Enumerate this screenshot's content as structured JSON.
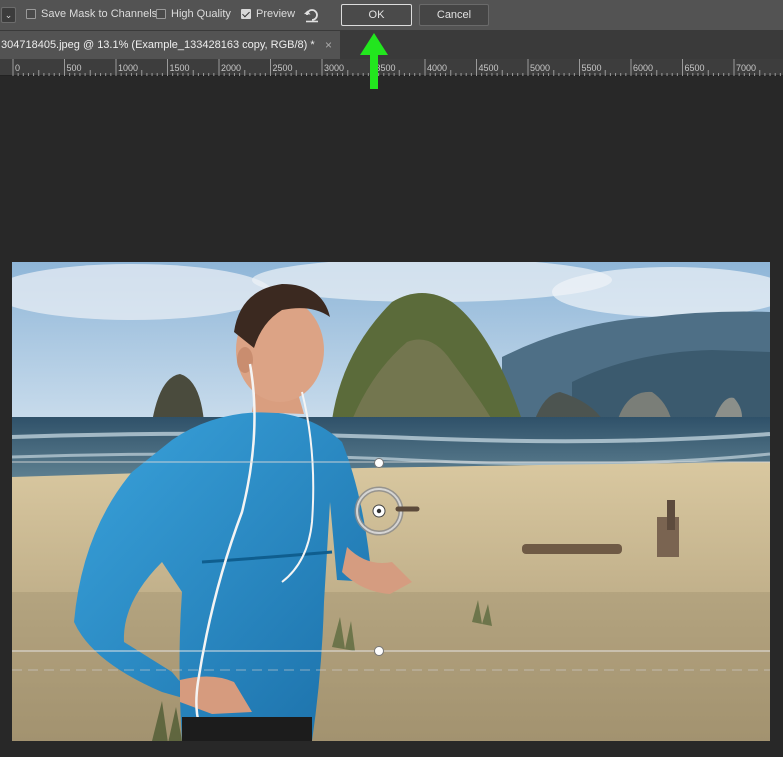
{
  "options_bar": {
    "save_mask_label": "Save Mask to Channels",
    "save_mask_checked": false,
    "high_quality_label": "High Quality",
    "high_quality_checked": false,
    "preview_label": "Preview",
    "preview_checked": true,
    "ok_label": "OK",
    "cancel_label": "Cancel",
    "reset_icon": "reset-icon"
  },
  "document_tab": {
    "title": "304718405.jpeg @ 13.1% (Example_133428163 copy, RGB/8) *",
    "close_glyph": "×"
  },
  "ruler": {
    "labels": [
      "0",
      "500",
      "1000",
      "1500",
      "2000",
      "2500",
      "3000",
      "3500",
      "4000",
      "4500",
      "5000",
      "5500",
      "6000",
      "6500",
      "7000"
    ]
  },
  "colors": {
    "accent_arrow": "#22e61e",
    "panel": "#535353",
    "canvas_bg": "#282828"
  }
}
